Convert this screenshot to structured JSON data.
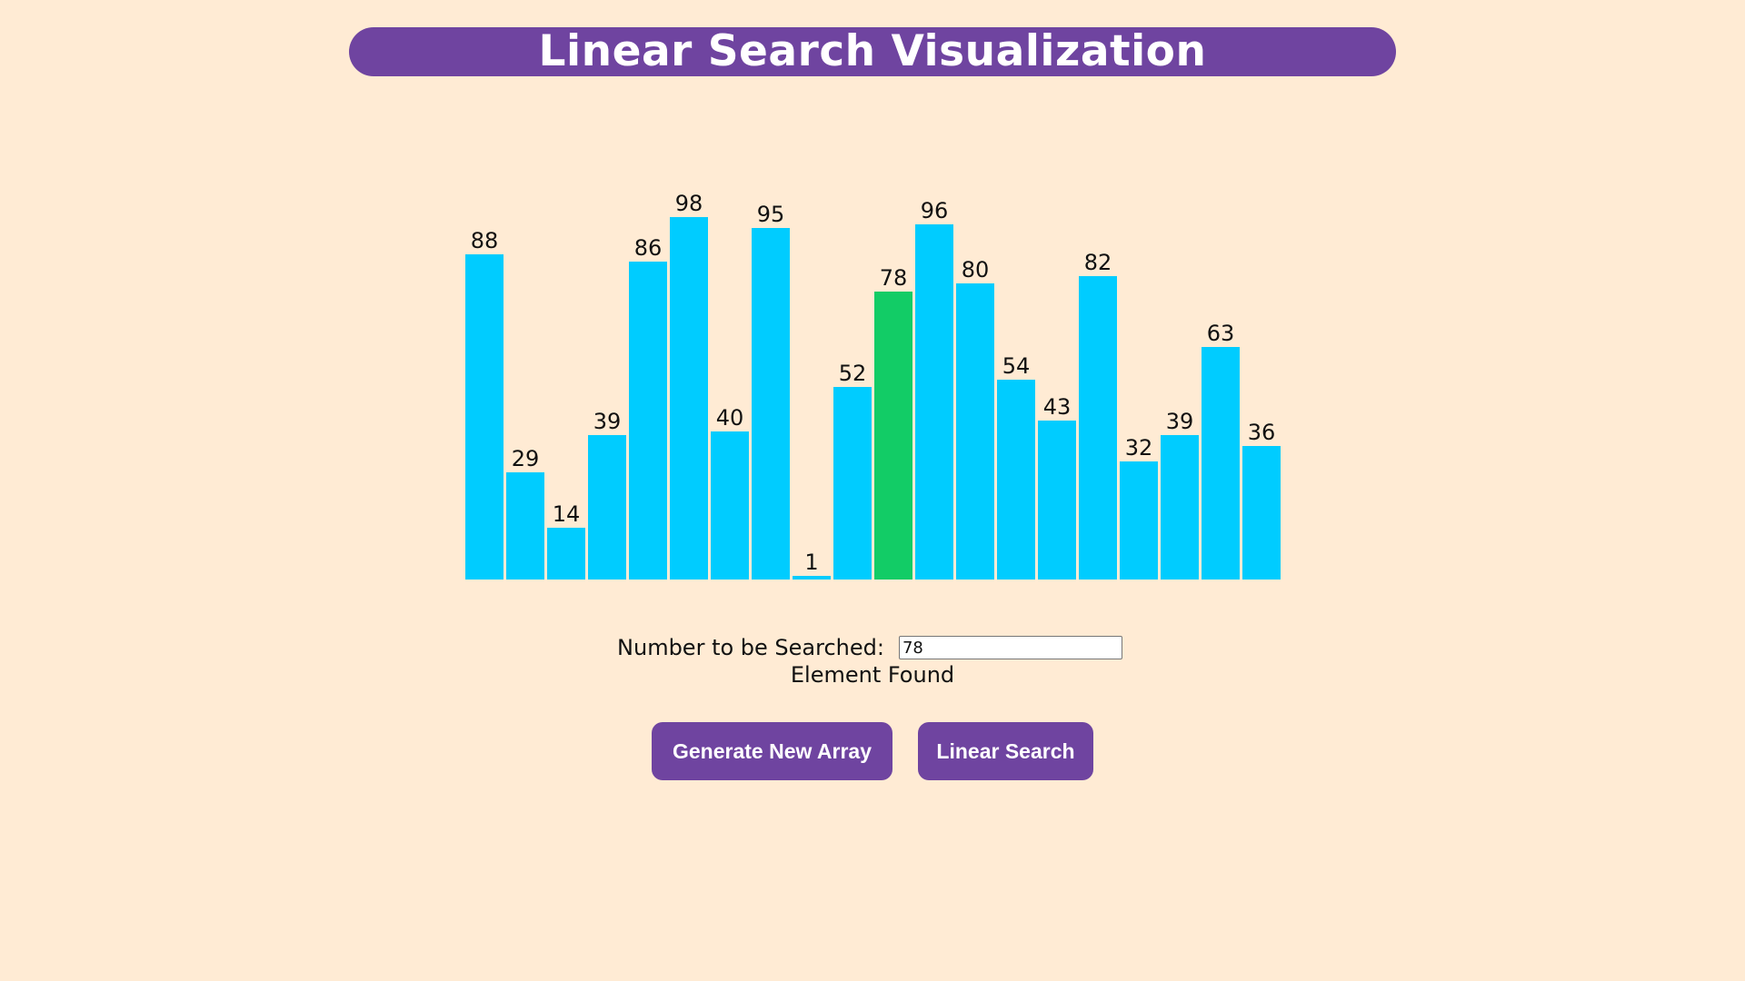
{
  "page": {
    "title": "Linear Search Visualization"
  },
  "chart_data": {
    "type": "bar",
    "values": [
      88,
      29,
      14,
      39,
      86,
      98,
      40,
      95,
      1,
      52,
      78,
      96,
      80,
      54,
      43,
      82,
      32,
      39,
      63,
      36
    ],
    "highlight_index": 10,
    "colors": {
      "bar": "#00ccff",
      "found": "#12cc66"
    }
  },
  "search": {
    "label": "Number to be Searched:",
    "value": "78",
    "status": "Element Found"
  },
  "buttons": {
    "generate_label": "Generate New Array",
    "search_label": "Linear Search"
  },
  "colors": {
    "background": "#ffebd4",
    "accent": "#6f44a0"
  }
}
